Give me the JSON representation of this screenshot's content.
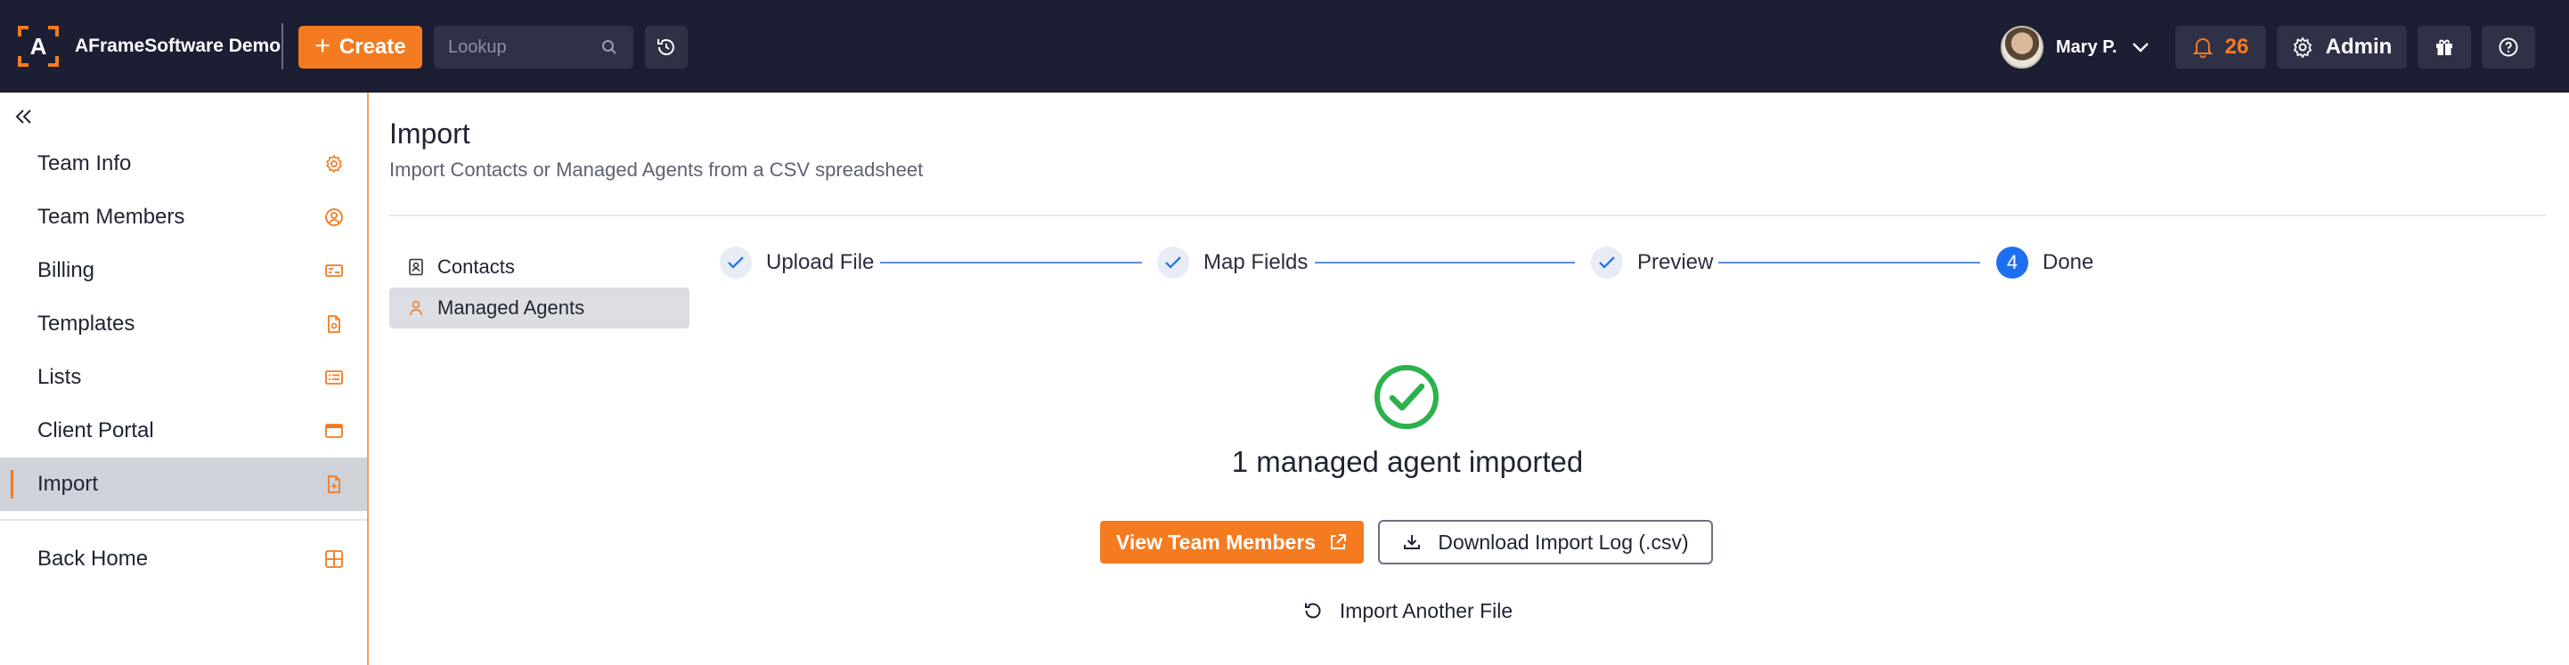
{
  "header": {
    "brand_initial": "A",
    "brand_name": "AFrameSoftware Demo",
    "create_label": "Create",
    "lookup_placeholder": "Lookup",
    "user_name": "Mary P.",
    "notification_count": "26",
    "admin_label": "Admin",
    "icons": [
      "plus-icon",
      "search-icon",
      "history-icon",
      "chevron-down-icon",
      "bell-icon",
      "gear-icon",
      "gift-icon",
      "help-icon"
    ]
  },
  "sidebar": {
    "items": [
      {
        "label": "Team Info",
        "icon": "gear-icon"
      },
      {
        "label": "Team Members",
        "icon": "user-circle-icon"
      },
      {
        "label": "Billing",
        "icon": "billing-card-icon"
      },
      {
        "label": "Templates",
        "icon": "document-icon"
      },
      {
        "label": "Lists",
        "icon": "list-icon"
      },
      {
        "label": "Client Portal",
        "icon": "portal-icon"
      },
      {
        "label": "Import",
        "icon": "import-file-icon",
        "active": true
      }
    ],
    "back_home_label": "Back Home"
  },
  "main": {
    "title": "Import",
    "subtitle": "Import Contacts or Managed Agents from a CSV spreadsheet",
    "subnav": [
      {
        "label": "Contacts",
        "icon": "contact-book-icon"
      },
      {
        "label": "Managed Agents",
        "icon": "agent-icon",
        "active": true
      }
    ],
    "steps": [
      {
        "label": "Upload File",
        "state": "complete"
      },
      {
        "label": "Map Fields",
        "state": "complete"
      },
      {
        "label": "Preview",
        "state": "complete"
      },
      {
        "label": "Done",
        "state": "current",
        "number": "4"
      }
    ],
    "result_text": "1 managed agent imported",
    "view_team_label": "View Team Members",
    "download_log_label": "Download Import Log (.csv)",
    "import_another_label": "Import Another File"
  },
  "colors": {
    "topbar": "#1c1f33",
    "accent": "#f47b20",
    "step_active": "#1d6ff2",
    "success": "#2bb24c"
  }
}
